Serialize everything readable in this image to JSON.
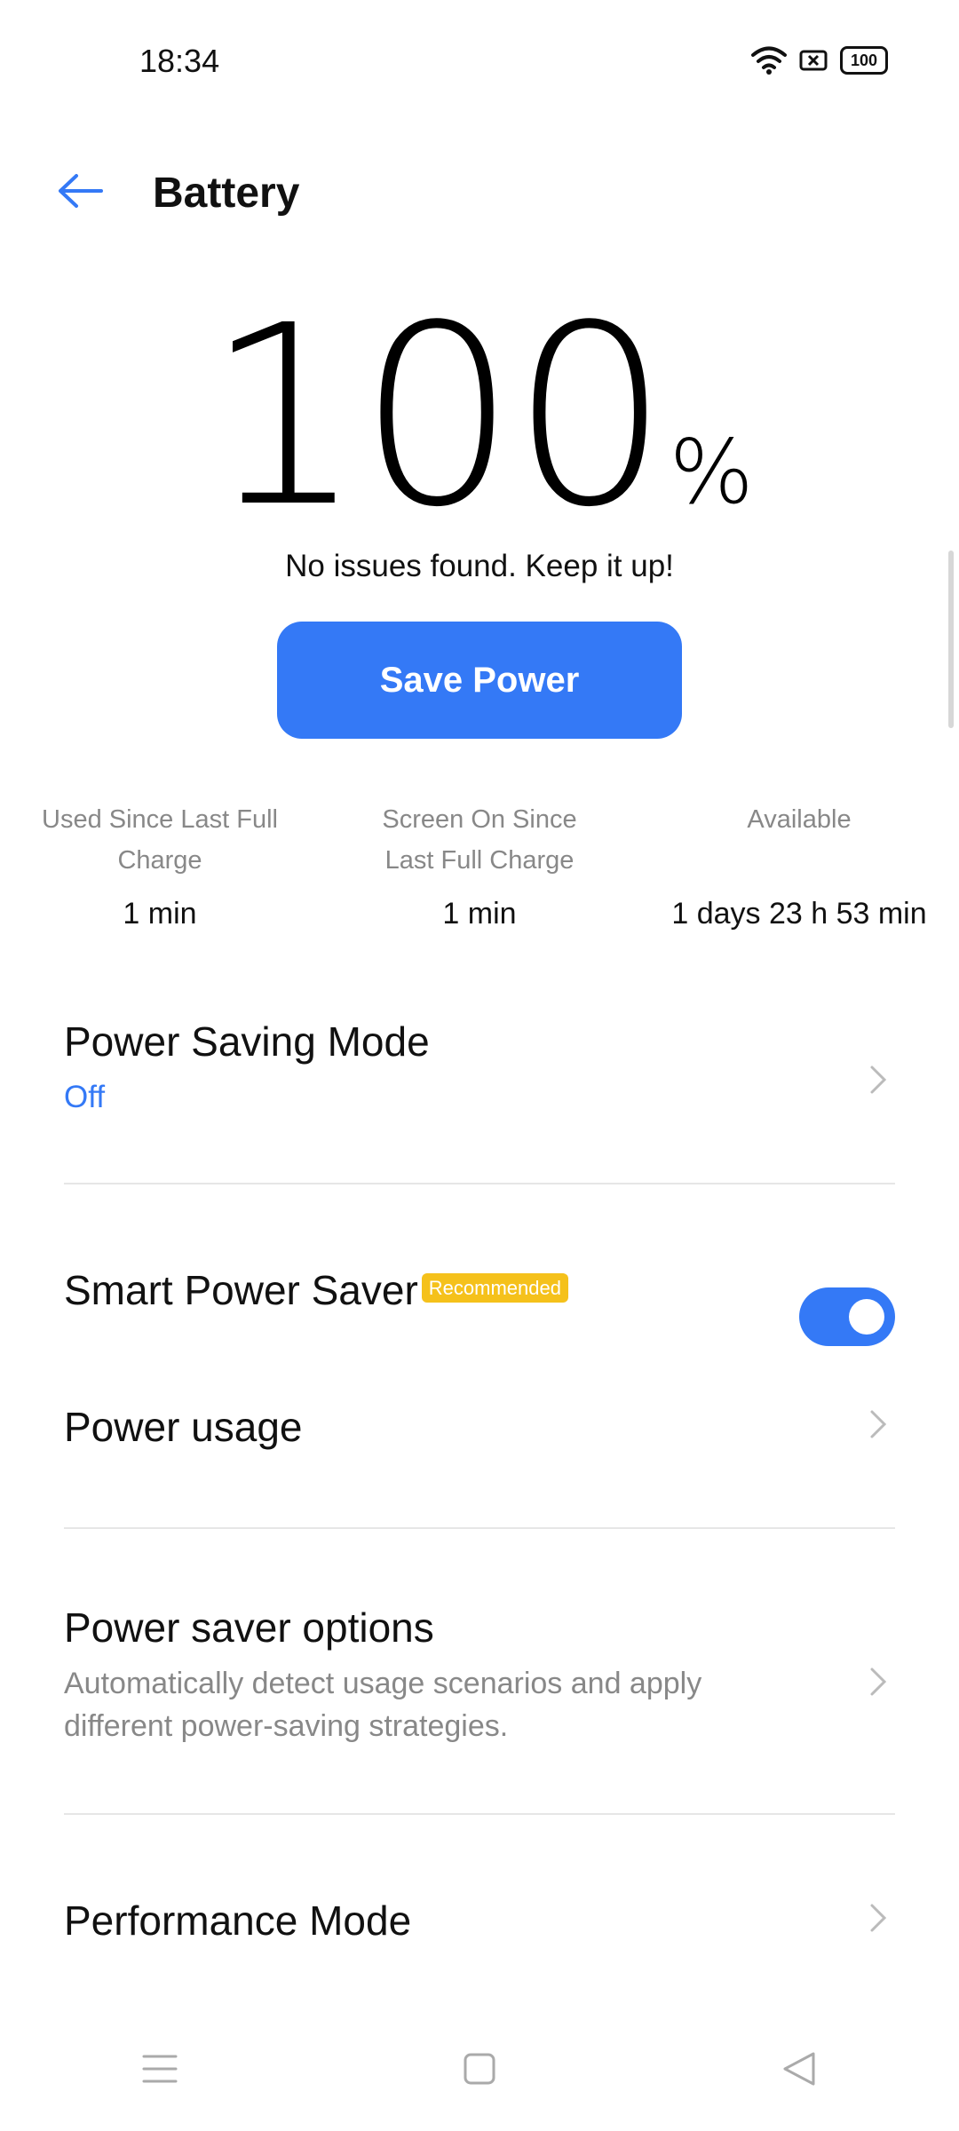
{
  "status_bar": {
    "time": "18:34",
    "battery_level": "100",
    "icons": [
      "wifi-icon",
      "no-sim-icon",
      "battery-icon"
    ]
  },
  "header": {
    "title": "Battery",
    "back_icon": "arrow-left-icon"
  },
  "battery": {
    "percent_value": "100",
    "percent_sign": "%",
    "status_message": "No issues found. Keep it up!"
  },
  "save_power_button": {
    "label": "Save Power"
  },
  "stats": [
    {
      "label": "Used Since Last Full Charge",
      "value": "1 min"
    },
    {
      "label": "Screen On Since Last Full Charge",
      "value": "1 min"
    },
    {
      "label": "Available",
      "value": "1 days 23 h 53 min"
    }
  ],
  "settings": {
    "power_saving_mode": {
      "title": "Power Saving Mode",
      "value": "Off"
    },
    "smart_power_saver": {
      "title": "Smart Power Saver",
      "badge": "Recommended",
      "enabled": true
    },
    "power_usage": {
      "title": "Power usage"
    },
    "power_saver_options": {
      "title": "Power saver options",
      "description": "Automatically detect usage scenarios and apply different power-saving strategies."
    },
    "performance_mode": {
      "title": "Performance Mode"
    }
  },
  "colors": {
    "accent": "#3479f6",
    "badge": "#f5c11b",
    "muted_text": "#888888",
    "divider": "#e6e6e6"
  },
  "nav_bar": {
    "icons": [
      "menu-icon",
      "home-icon",
      "back-icon"
    ]
  }
}
